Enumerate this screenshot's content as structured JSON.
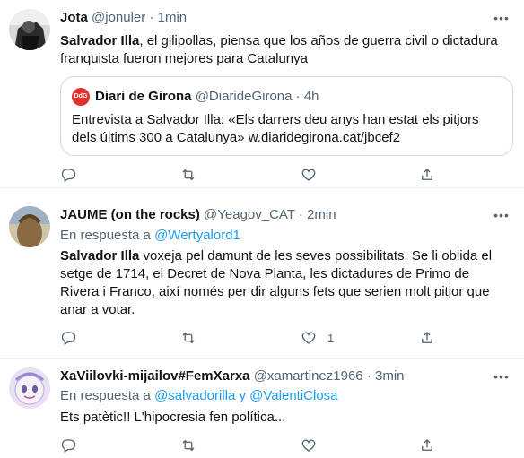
{
  "tweets": [
    {
      "name": "Jota",
      "handle": "@jonuler",
      "dot": "·",
      "time": "1min",
      "body_bold": "Salvador Illa",
      "body_rest": ", el gilipollas, piensa que los años de guerra civil o dictadura franquista fueron mejores  para Catalunya",
      "quote": {
        "avatar_text": "DdG",
        "name": "Diari de Girona",
        "handle": "@DiarideGirona",
        "dot": "·",
        "time": "4h",
        "body": "Entrevista a Salvador Illa: «Els darrers deu anys han estat els pitjors dels últims 300 a Catalunya» w.diaridegirona.cat/jbcef2"
      }
    },
    {
      "name": "JAUME (on the rocks)",
      "handle": "@Yeagov_CAT",
      "dot": "·",
      "time": "2min",
      "reply_prefix": "En respuesta a ",
      "reply_to": "@Wertyalord1",
      "body_bold": "Salvador Illa",
      "body_rest": " voxeja pel damunt de les seves possibilitats. Se li oblida el setge de 1714, el Decret de Nova Planta, les dictadures de Primo de Rivera i Franco, així només per dir alguns fets que serien molt pitjor que anar a votar.",
      "like_count": "1"
    },
    {
      "name": "XaViilovki-mijailov#FemXarxa",
      "handle": "@xamartinez1966",
      "dot": "·",
      "time": "3min",
      "reply_prefix": "En respuesta a ",
      "reply_to": "@salvadorilla y @ValentiClosa",
      "body": "Ets patètic!! L'hipocresia fen política..."
    }
  ],
  "icons": [
    "reply-icon",
    "retweet-icon",
    "like-icon",
    "share-icon",
    "more-icon"
  ],
  "colors": {
    "link": "#1d9bf0",
    "muted": "#536471",
    "text": "#0f1419",
    "border": "#cfd9de"
  }
}
